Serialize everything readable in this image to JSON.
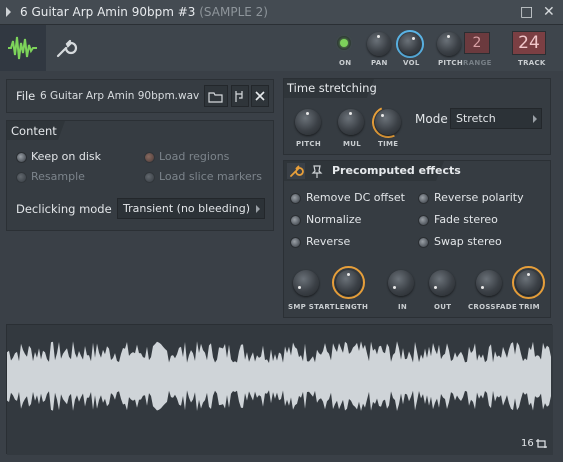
{
  "window": {
    "title": "6 Guitar Arp Amin 90bpm #3",
    "subtitle": "(SAMPLE 2)",
    "restore_glyph": "□",
    "close_glyph": "✕"
  },
  "toolbar": {
    "on_label": "ON",
    "pan_label": "PAN",
    "vol_label": "VOL",
    "pitch_label": "PITCH",
    "range_label": "RANGE",
    "range_value": "2",
    "track_label": "TRACK",
    "track_value": "24",
    "accent_orange": "#e79f3a",
    "accent_blue": "#5ab4e6",
    "led_color": "#7dd35a"
  },
  "file": {
    "label": "File",
    "name": "6 Guitar Arp Amin 90bpm.wav"
  },
  "content": {
    "title": "Content",
    "keep_on_disk": "Keep on disk",
    "resample": "Resample",
    "load_regions": "Load regions",
    "load_slice_markers": "Load slice markers",
    "declicking_label": "Declicking mode",
    "declicking_value": "Transient (no bleeding)"
  },
  "time_stretching": {
    "title": "Time stretching",
    "pitch": "PITCH",
    "mul": "MUL",
    "time": "TIME",
    "mode_label": "Mode",
    "mode_value": "Stretch"
  },
  "precomputed": {
    "title": "Precomputed effects",
    "remove_dc": "Remove DC offset",
    "normalize": "Normalize",
    "reverse": "Reverse",
    "reverse_polarity": "Reverse polarity",
    "fade_stereo": "Fade stereo",
    "swap_stereo": "Swap stereo",
    "smp_start": "SMP START",
    "length": "LENGTH",
    "in": "IN",
    "out": "OUT",
    "crossfade": "CROSSFADE",
    "trim": "TRIM"
  },
  "waveform": {
    "zoom_value": "16"
  }
}
